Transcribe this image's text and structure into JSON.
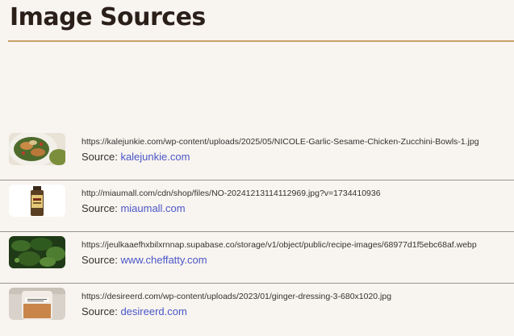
{
  "page": {
    "title": "Image Sources",
    "colors": {
      "background": "#f8f4ef",
      "title_rule": "#c7a06a",
      "link": "#4a57c9"
    }
  },
  "sources": [
    {
      "thumb_icon": "chicken-zucchini-bowls-thumbnail",
      "url": "https://kalejunkie.com/wp-content/uploads/2025/05/NICOLE-Garlic-Sesame-Chicken-Zucchini-Bowls-1.jpg",
      "source_label": "Source:",
      "source_name": "kalejunkie.com"
    },
    {
      "thumb_icon": "sauce-bottle-thumbnail",
      "url": "http://miaumall.com/cdn/shop/files/NO-20241213114112969.jpg?v=1734410936",
      "source_label": "Source:",
      "source_name": "miaumall.com"
    },
    {
      "thumb_icon": "greens-thumbnail",
      "url": "https://jeulkaaefhxbilxrnnap.supabase.co/storage/v1/object/public/recipe-images/68977d1f5ebc68af.webp",
      "source_label": "Source:",
      "source_name": "www.cheffatty.com"
    },
    {
      "thumb_icon": "ginger-dressing-jar-thumbnail",
      "url": "https://desireerd.com/wp-content/uploads/2023/01/ginger-dressing-3-680x1020.jpg",
      "source_label": "Source:",
      "source_name": "desireerd.com"
    }
  ]
}
